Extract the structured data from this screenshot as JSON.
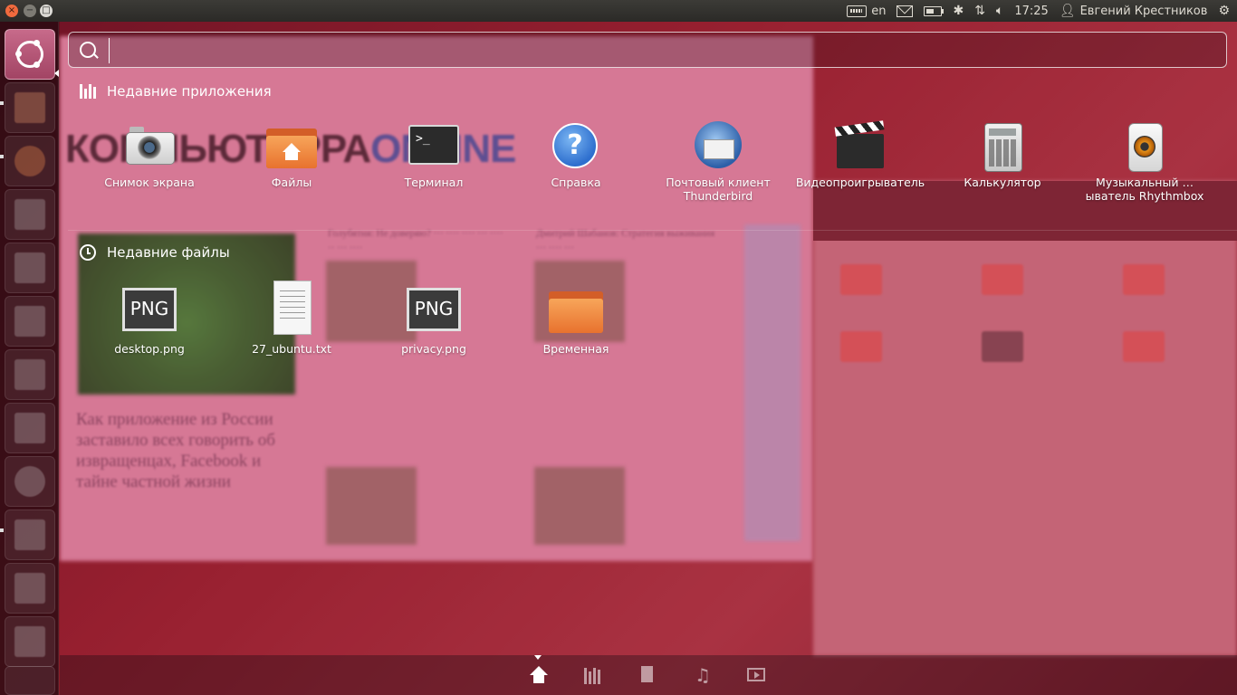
{
  "top_panel": {
    "keyboard_layout": "en",
    "time": "17:25",
    "user_name": "Евгений Крестников",
    "icons": [
      "keyboard-icon",
      "mail-icon",
      "battery-icon",
      "bluetooth-icon",
      "network-icon",
      "volume-icon",
      "user-icon",
      "session-gear-icon"
    ]
  },
  "window_controls": {
    "close": "×",
    "minimize": "−",
    "maximize": "□"
  },
  "launcher": {
    "items": [
      "dash-home",
      "nautilus-files",
      "firefox",
      "libreoffice-writer",
      "libreoffice-calc",
      "libreoffice-impress",
      "software-center",
      "ubuntu-one",
      "system-settings",
      "text-editor",
      "workspace-switcher",
      "trash"
    ]
  },
  "search": {
    "value": "",
    "placeholder": ""
  },
  "sections": {
    "recent_apps": "Недавние приложения",
    "recent_files": "Недавние файлы"
  },
  "recent_apps": [
    {
      "label": "Снимок экрана",
      "icon": "camera-icon"
    },
    {
      "label": "Файлы",
      "icon": "home-folder-icon"
    },
    {
      "label": "Терминал",
      "icon": "terminal-icon"
    },
    {
      "label": "Справка",
      "icon": "help-icon"
    },
    {
      "label": "Почтовый клиент Thunderbird",
      "icon": "thunderbird-icon"
    },
    {
      "label": "Видеопроигрыватель",
      "icon": "video-player-icon"
    },
    {
      "label": "Калькулятор",
      "icon": "calculator-icon"
    },
    {
      "label": "Музыкальный …ыватель Rhythmbox",
      "icon": "rhythmbox-icon"
    }
  ],
  "recent_files": [
    {
      "label": "desktop.png",
      "badge": "PNG",
      "icon": "png-file-icon"
    },
    {
      "label": "27_ubuntu.txt",
      "icon": "text-file-icon"
    },
    {
      "label": "privacy.png",
      "badge": "PNG",
      "icon": "png-file-icon"
    },
    {
      "label": "Временная",
      "icon": "folder-icon"
    }
  ],
  "lenses": [
    "home-lens",
    "applications-lens",
    "files-lens",
    "music-lens",
    "video-lens"
  ],
  "terminal_prompt": ">_",
  "help_glyph": "?",
  "music_glyph": "♫",
  "bluetooth_glyph": "✱",
  "network_glyph": "⇅",
  "volume_glyph": "🔈︎",
  "user_glyph": "👤︎",
  "gear_glyph": "⚙"
}
